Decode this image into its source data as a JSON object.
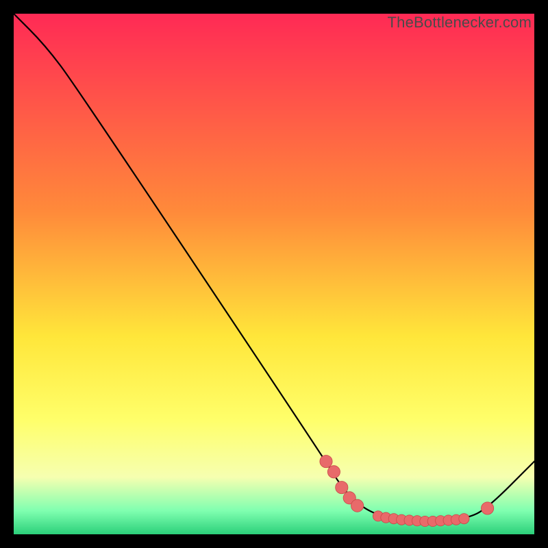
{
  "watermark": "TheBottlenecker.com",
  "colors": {
    "top": "#ff2a55",
    "mid1": "#ff8a3a",
    "mid2": "#ffe63a",
    "yellowish": "#ffff6a",
    "pale": "#f6ffb0",
    "green_lt": "#7fffb0",
    "green": "#2bd07a",
    "curve": "#000000",
    "point_fill": "#e86a6a",
    "point_stroke": "#c84848"
  },
  "chart_data": {
    "type": "line",
    "title": "",
    "xlabel": "",
    "ylabel": "",
    "xlim": [
      0,
      100
    ],
    "ylim": [
      0,
      100
    ],
    "gradient_stops": [
      {
        "offset": 0.0,
        "color": "#ff2a55"
      },
      {
        "offset": 0.38,
        "color": "#ff8a3a"
      },
      {
        "offset": 0.62,
        "color": "#ffe63a"
      },
      {
        "offset": 0.78,
        "color": "#ffff6a"
      },
      {
        "offset": 0.89,
        "color": "#f6ffb0"
      },
      {
        "offset": 0.955,
        "color": "#7fffb0"
      },
      {
        "offset": 1.0,
        "color": "#2bd07a"
      }
    ],
    "curve": [
      {
        "x": 0,
        "y": 100
      },
      {
        "x": 6,
        "y": 94
      },
      {
        "x": 12,
        "y": 86
      },
      {
        "x": 60,
        "y": 14
      },
      {
        "x": 63,
        "y": 9
      },
      {
        "x": 67,
        "y": 5
      },
      {
        "x": 72,
        "y": 3
      },
      {
        "x": 80,
        "y": 2.5
      },
      {
        "x": 87,
        "y": 3
      },
      {
        "x": 91,
        "y": 5
      },
      {
        "x": 100,
        "y": 14
      }
    ],
    "points": [
      {
        "x": 60,
        "y": 14,
        "r": 1.2
      },
      {
        "x": 61.5,
        "y": 12,
        "r": 1.2
      },
      {
        "x": 63,
        "y": 9,
        "r": 1.2
      },
      {
        "x": 64.5,
        "y": 7,
        "r": 1.2
      },
      {
        "x": 66,
        "y": 5.5,
        "r": 1.2
      },
      {
        "x": 70,
        "y": 3.5,
        "r": 1.0
      },
      {
        "x": 71.5,
        "y": 3.2,
        "r": 1.0
      },
      {
        "x": 73,
        "y": 3.0,
        "r": 1.0
      },
      {
        "x": 74.5,
        "y": 2.8,
        "r": 1.0
      },
      {
        "x": 76,
        "y": 2.7,
        "r": 1.0
      },
      {
        "x": 77.5,
        "y": 2.6,
        "r": 1.0
      },
      {
        "x": 79,
        "y": 2.5,
        "r": 1.0
      },
      {
        "x": 80.5,
        "y": 2.5,
        "r": 1.0
      },
      {
        "x": 82,
        "y": 2.6,
        "r": 1.0
      },
      {
        "x": 83.5,
        "y": 2.7,
        "r": 1.0
      },
      {
        "x": 85,
        "y": 2.8,
        "r": 1.0
      },
      {
        "x": 86.5,
        "y": 3.0,
        "r": 1.0
      },
      {
        "x": 91,
        "y": 5,
        "r": 1.2
      }
    ]
  }
}
